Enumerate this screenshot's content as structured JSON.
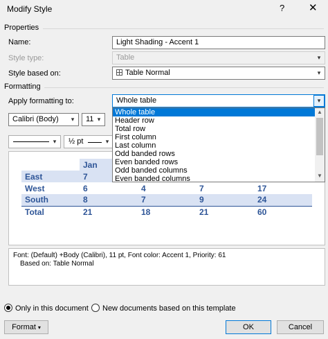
{
  "window": {
    "title": "Modify Style",
    "help": "?",
    "close": "✕"
  },
  "properties": {
    "header": "Properties",
    "name_label": "Name:",
    "name_value": "Light Shading - Accent 1",
    "type_label": "Style type:",
    "type_value": "Table",
    "based_label": "Style based on:",
    "based_value": "Table Normal"
  },
  "formatting": {
    "header": "Formatting",
    "apply_label": "Apply formatting to:",
    "apply_value": "Whole table",
    "font": "Calibri (Body)",
    "size": "11",
    "border_width": "½ pt",
    "options": [
      "Whole table",
      "Header row",
      "Total row",
      "First column",
      "Last column",
      "Odd banded rows",
      "Even banded rows",
      "Odd banded columns",
      "Even banded columns"
    ]
  },
  "preview": {
    "header_col": "Jan",
    "rows": [
      {
        "label": "East",
        "c1": "7",
        "c2": "",
        "c3": "",
        "c4": ""
      },
      {
        "label": "West",
        "c1": "6",
        "c2": "4",
        "c3": "7",
        "c4": "17"
      },
      {
        "label": "South",
        "c1": "8",
        "c2": "7",
        "c3": "9",
        "c4": "24"
      },
      {
        "label": "Total",
        "c1": "21",
        "c2": "18",
        "c3": "21",
        "c4": "60"
      }
    ],
    "band_color": "#d9e2f3",
    "text_color": "#2e5597"
  },
  "description": {
    "line1": "Font: (Default) +Body (Calibri), 11 pt, Font color: Accent 1, Priority: 61",
    "line2": "Based on: Table Normal"
  },
  "options": {
    "only_this_doc": "Only in this document",
    "new_docs": "New documents based on this template"
  },
  "buttons": {
    "format": "Format",
    "ok": "OK",
    "cancel": "Cancel"
  },
  "accent_color": "#0078d7"
}
